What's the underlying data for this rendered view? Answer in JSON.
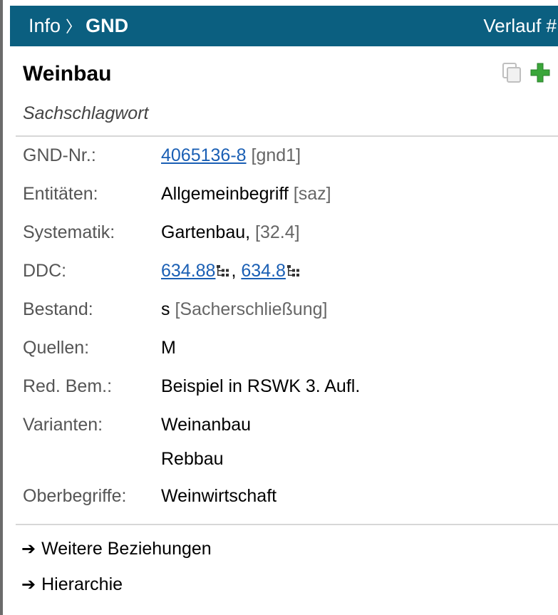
{
  "header": {
    "crumb_root": "Info",
    "crumb_separator": "〉",
    "crumb_current": "GND",
    "history_label": "Verlauf",
    "history_suffix": "#",
    "bg_color": "#0b5f80"
  },
  "record": {
    "title": "Weinbau",
    "type": "Sachschlagwort",
    "actions": {
      "copy_icon": "copy-icon",
      "add_icon": "plus-icon",
      "add_color": "#3aa63a"
    }
  },
  "fields": {
    "gnd": {
      "label": "GND-Nr.:",
      "link": "4065136-8",
      "extra": "[gnd1]"
    },
    "entitaeten": {
      "label": "Entitäten:",
      "value": "Allgemeinbegriff",
      "extra": "[saz]"
    },
    "systematik": {
      "label": "Systematik:",
      "value": "Gartenbau,",
      "extra": "[32.4]"
    },
    "ddc": {
      "label": "DDC:",
      "link1": "634.88",
      "separator": ",",
      "link2": "634.8",
      "icon": "hierarchy-tree-icon"
    },
    "bestand": {
      "label": "Bestand:",
      "value": "s",
      "extra": "[Sacherschließung]"
    },
    "quellen": {
      "label": "Quellen:",
      "value": "M"
    },
    "red_bem": {
      "label": "Red. Bem.:",
      "value": "Beispiel in RSWK 3. Aufl."
    },
    "varianten": {
      "label": "Varianten:",
      "values": [
        "Weinanbau",
        "Rebbau"
      ]
    },
    "oberbegriffe": {
      "label": "Oberbegriffe:",
      "value": "Weinwirtschaft"
    }
  },
  "links": {
    "arrow": "➔",
    "more_relations": "Weitere Beziehungen",
    "hierarchy": "Hierarchie"
  },
  "colors": {
    "link": "#1a5fb4",
    "label": "#555555",
    "rule": "#d7d7d7"
  }
}
